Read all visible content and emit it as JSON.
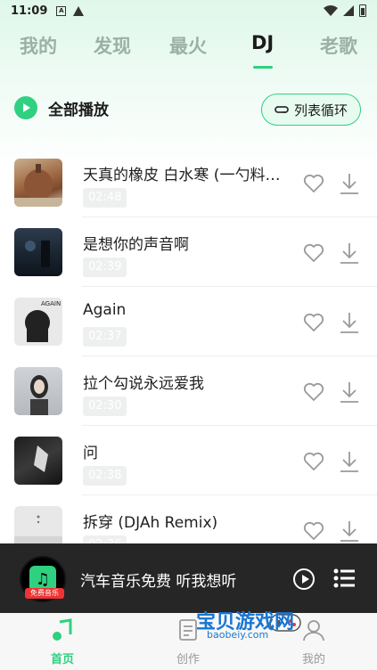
{
  "status_bar": {
    "time": "11:09",
    "icon_a": "A"
  },
  "tabs": [
    {
      "label": "我的"
    },
    {
      "label": "发现"
    },
    {
      "label": "最火"
    },
    {
      "label": "DJ"
    },
    {
      "label": "老歌"
    }
  ],
  "play_all_label": "全部播放",
  "loop_mode_label": "列表循环",
  "songs": [
    {
      "title": "天真的橡皮 白水寒 (一勺料…",
      "duration": "02:48"
    },
    {
      "title": "是想你的声音啊",
      "duration": "02:39"
    },
    {
      "title": "Again",
      "duration": "02:37"
    },
    {
      "title": "拉个勾说永远爱我",
      "duration": "02:30"
    },
    {
      "title": "问",
      "duration": "02:38"
    },
    {
      "title": "拆穿 (DJAh Remix)",
      "duration": "02:36"
    }
  ],
  "thumb3_text": "AGAIN",
  "player": {
    "title": "汽车音乐免费   听我想听",
    "badge": "免费音乐",
    "disc_icon": "music-note-icon"
  },
  "bottom_nav": {
    "home": "首页",
    "create": "创作",
    "mine": "我的"
  },
  "watermark": {
    "title": "宝贝游戏网",
    "url": "baobeiy.com"
  },
  "colors": {
    "accent": "#2fd080",
    "player_bg": "#262626"
  }
}
